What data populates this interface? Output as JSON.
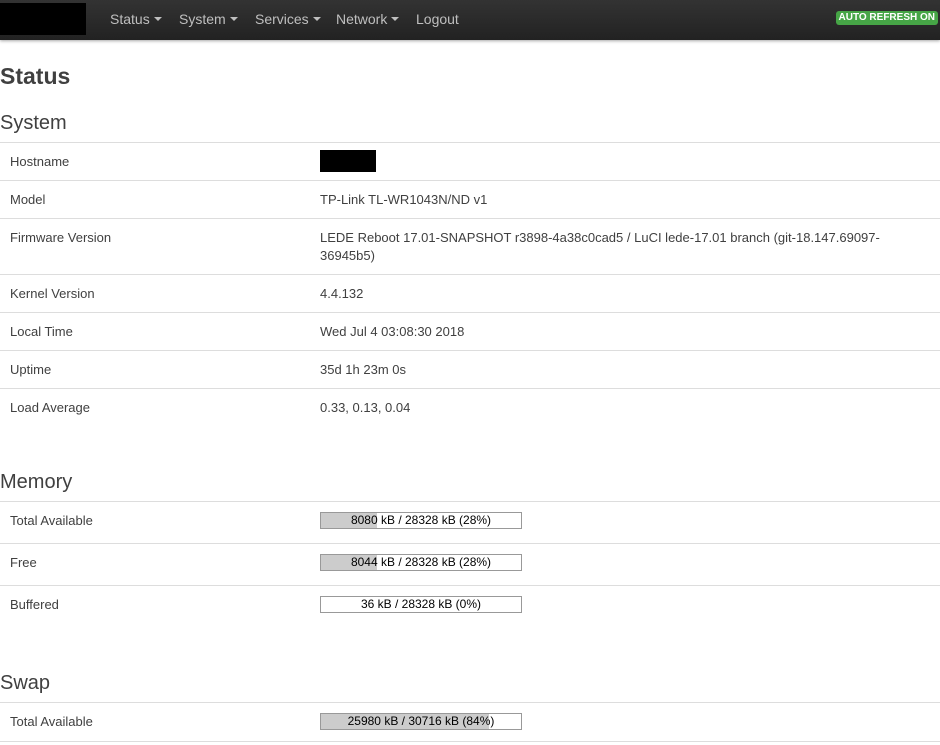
{
  "nav": {
    "items": [
      {
        "label": "Status",
        "dropdown": true
      },
      {
        "label": "System",
        "dropdown": true
      },
      {
        "label": "Services",
        "dropdown": true
      },
      {
        "label": "Network",
        "dropdown": true
      },
      {
        "label": "Logout",
        "dropdown": false
      }
    ],
    "refresh_badge": "AUTO REFRESH ON"
  },
  "page_title": "Status",
  "system": {
    "title": "System",
    "rows": [
      {
        "label": "Hostname",
        "value": ""
      },
      {
        "label": "Model",
        "value": "TP-Link TL-WR1043N/ND v1"
      },
      {
        "label": "Firmware Version",
        "value": "LEDE Reboot 17.01-SNAPSHOT r3898-4a38c0cad5 / LuCI lede-17.01 branch (git-18.147.69097-36945b5)"
      },
      {
        "label": "Kernel Version",
        "value": "4.4.132"
      },
      {
        "label": "Local Time",
        "value": "Wed Jul 4 03:08:30 2018"
      },
      {
        "label": "Uptime",
        "value": "35d 1h 23m 0s"
      },
      {
        "label": "Load Average",
        "value": "0.33, 0.13, 0.04"
      }
    ]
  },
  "memory": {
    "title": "Memory",
    "rows": [
      {
        "label": "Total Available",
        "text": "8080 kB / 28328 kB (28%)",
        "fraction": 0.28
      },
      {
        "label": "Free",
        "text": "8044 kB / 28328 kB (28%)",
        "fraction": 0.28
      },
      {
        "label": "Buffered",
        "text": "36 kB / 28328 kB (0%)",
        "fraction": 0.0
      }
    ]
  },
  "swap": {
    "title": "Swap",
    "rows": [
      {
        "label": "Total Available",
        "text": "25980 kB / 30716 kB (84%)",
        "fraction": 0.84
      }
    ]
  },
  "colors": {
    "navbar": "#222222",
    "badge": "#46a546",
    "bar_fill": "#cccccc"
  }
}
